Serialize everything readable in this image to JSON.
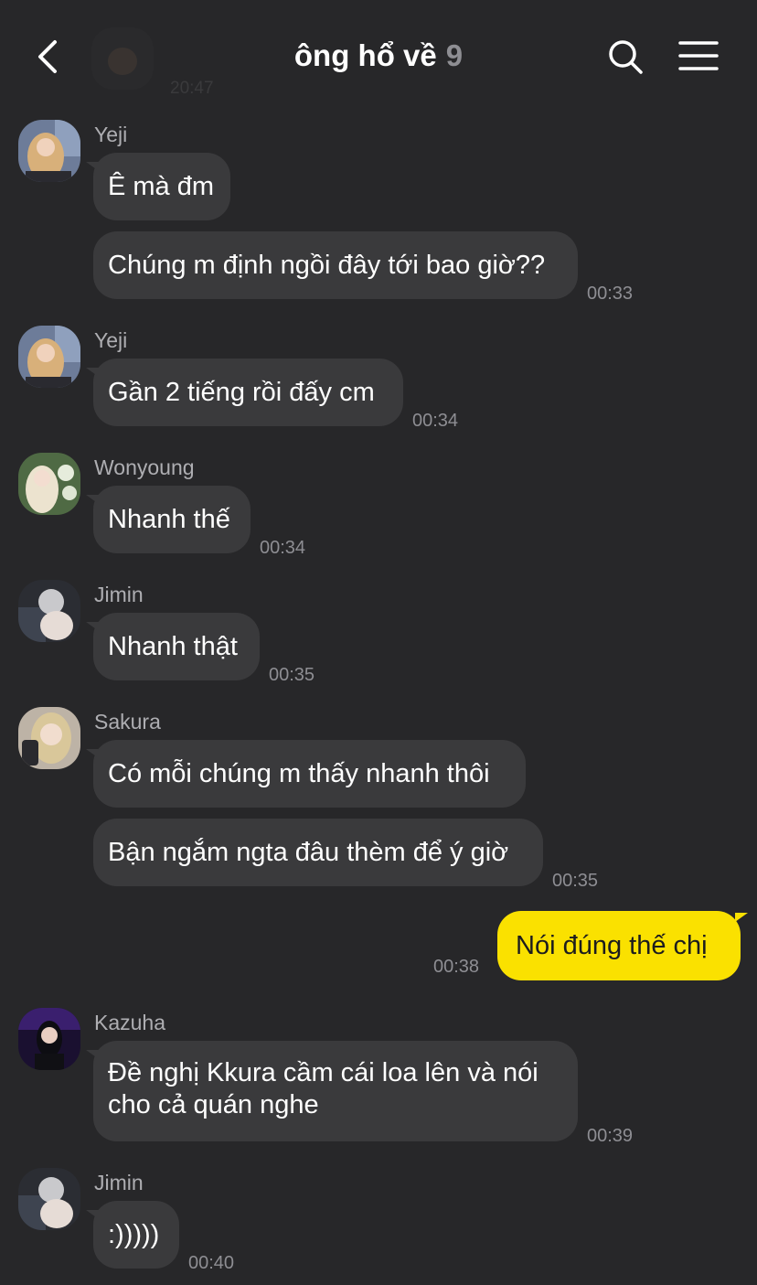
{
  "header": {
    "title": "ông hổ về",
    "member_count": "9",
    "previous_time": "20:47",
    "back_icon": "chevron-left-icon",
    "search_icon": "search-icon",
    "menu_icon": "hamburger-menu-icon"
  },
  "colors": {
    "background": "#272729",
    "received_bubble": "#3a3a3c",
    "sent_bubble": "#fae100",
    "timestamp": "#8e8e93"
  },
  "messages": [
    {
      "sender": "Yeji",
      "text": "Ê mà đm"
    },
    {
      "text": "Chúng m định ngồi đây tới bao giờ??",
      "time": "00:33"
    },
    {
      "sender": "Yeji",
      "text": "Gần 2 tiếng rồi đấy cm",
      "time": "00:34"
    },
    {
      "sender": "Wonyoung",
      "text": "Nhanh thế",
      "time": "00:34"
    },
    {
      "sender": "Jimin",
      "text": "Nhanh thật",
      "time": "00:35"
    },
    {
      "sender": "Sakura",
      "text": "Có mỗi chúng m thấy nhanh thôi"
    },
    {
      "text": "Bận ngắm ngta đâu thèm để ý giờ",
      "time": "00:35"
    },
    {
      "text": "Nói đúng thế chị",
      "time": "00:38",
      "mine": true
    },
    {
      "sender": "Kazuha",
      "text": "Đề nghị Kkura cầm cái loa lên và nói cho cả quán nghe",
      "time": "00:39"
    },
    {
      "sender": "Jimin",
      "text": ":)))))",
      "time": "00:40"
    }
  ]
}
